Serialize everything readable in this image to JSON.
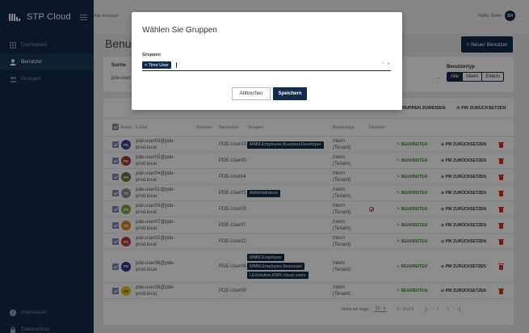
{
  "app": {
    "title": "STP Cloud"
  },
  "sidebar": {
    "items": [
      {
        "label": "Dashboard"
      },
      {
        "label": "Benutzer"
      },
      {
        "label": "Gruppen"
      }
    ],
    "bottom": [
      {
        "label": "Impressum"
      },
      {
        "label": "Datenschutz"
      }
    ]
  },
  "topbar": {
    "breadcrumb": "Alle Anwend",
    "user_greeting": "Hallo Sven",
    "user_initials": "SH"
  },
  "page": {
    "title": "Benutz",
    "new_user_button": "+ Neuer Benutzer"
  },
  "filter": {
    "search_label": "Suche",
    "search_value": "pde-user",
    "usertype_label": "Benutzertyp",
    "usertype_options": [
      "Alle",
      "Intern",
      "Extern"
    ]
  },
  "actions": {
    "assign_groups": "RUPPEN ZUWEISEN",
    "pw_reset": "PW ZURÜCKSETZEN"
  },
  "table": {
    "headers": {
      "avatar": "Avatar",
      "email": "E-Mail",
      "firstname": "Vorname",
      "lastname": "Nachname",
      "groups": "Gruppen",
      "usertype": "Benutzertyp",
      "locked": "Gesperrt"
    },
    "edit_label": "BEARBEITEN",
    "pw_label": "PW ZURÜCKSETZEN",
    "rows": [
      {
        "initials": "PD",
        "email1": "pde-user03@pde-",
        "email2": "prod.local",
        "lastname": "PDE-User03",
        "groups": [
          "MMM.Employee.BusinessDeveloper"
        ],
        "type1": "Intern",
        "type2": "(Tenant)",
        "locked": false
      },
      {
        "initials": "PD",
        "email1": "pde-user05@pde-",
        "email2": "prod.local",
        "lastname": "PDE-User05",
        "groups": [],
        "type1": "Intern",
        "type2": "(Tenant)",
        "locked": false
      },
      {
        "initials": "PD",
        "email1": "pde-user04@pde-",
        "email2": "prod.local",
        "lastname": "PDE-User04",
        "groups": [],
        "type1": "Intern",
        "type2": "(Tenant)",
        "locked": false
      },
      {
        "initials": "PD",
        "email1": "pde-user01@pde-",
        "email2": "prod.local",
        "lastname": "PDE-User01",
        "groups": [
          "Administrators"
        ],
        "type1": "Intern",
        "type2": "(Tenant)",
        "locked": false
      },
      {
        "initials": "PD",
        "email1": "pde-user09@pde-",
        "email2": "prod.local",
        "lastname": "PDE-User09",
        "groups": [],
        "type1": "Intern",
        "type2": "(Tenant)",
        "locked": true
      },
      {
        "initials": "PD",
        "email1": "pde-user07@pde-",
        "email2": "prod.local",
        "lastname": "PDE-User07",
        "groups": [],
        "type1": "Intern",
        "type2": "(Tenant)",
        "locked": false
      },
      {
        "initials": "PD",
        "email1": "pde-user02@pde-",
        "email2": "prod.local",
        "lastname": "PDE-User02",
        "groups": [],
        "type1": "Intern",
        "type2": "(Tenant)",
        "locked": false
      },
      {
        "initials": "PD",
        "email1": "pde-user06@pde-",
        "email2": "prod.local",
        "lastname": "PDE-User06",
        "groups": [
          "MMM.Employee",
          "MMM.Employee.Associate",
          "LEXolution.KMS cloud users"
        ],
        "type1": "Intern",
        "type2": "(Tenant)",
        "locked": false
      },
      {
        "initials": "PD",
        "email1": "pde-user08@pde-",
        "email2": "prod.local",
        "lastname": "PDE-User08",
        "groups": [],
        "type1": "Intern",
        "type2": "(Tenant)",
        "locked": false
      }
    ]
  },
  "pager": {
    "items_label": "Items per page:",
    "page_size": "25",
    "range": "1 – 9 of 9"
  },
  "modal": {
    "title": "Wählen Sie Gruppen",
    "field_label": "Gruppen",
    "selected_chip": "× Time User",
    "cancel": "Abbrechen",
    "save": "Speichern"
  },
  "colors": {
    "primary": "#0f2c4c",
    "edit_green": "#3e8e2e",
    "delete_red": "#d32f2f"
  }
}
